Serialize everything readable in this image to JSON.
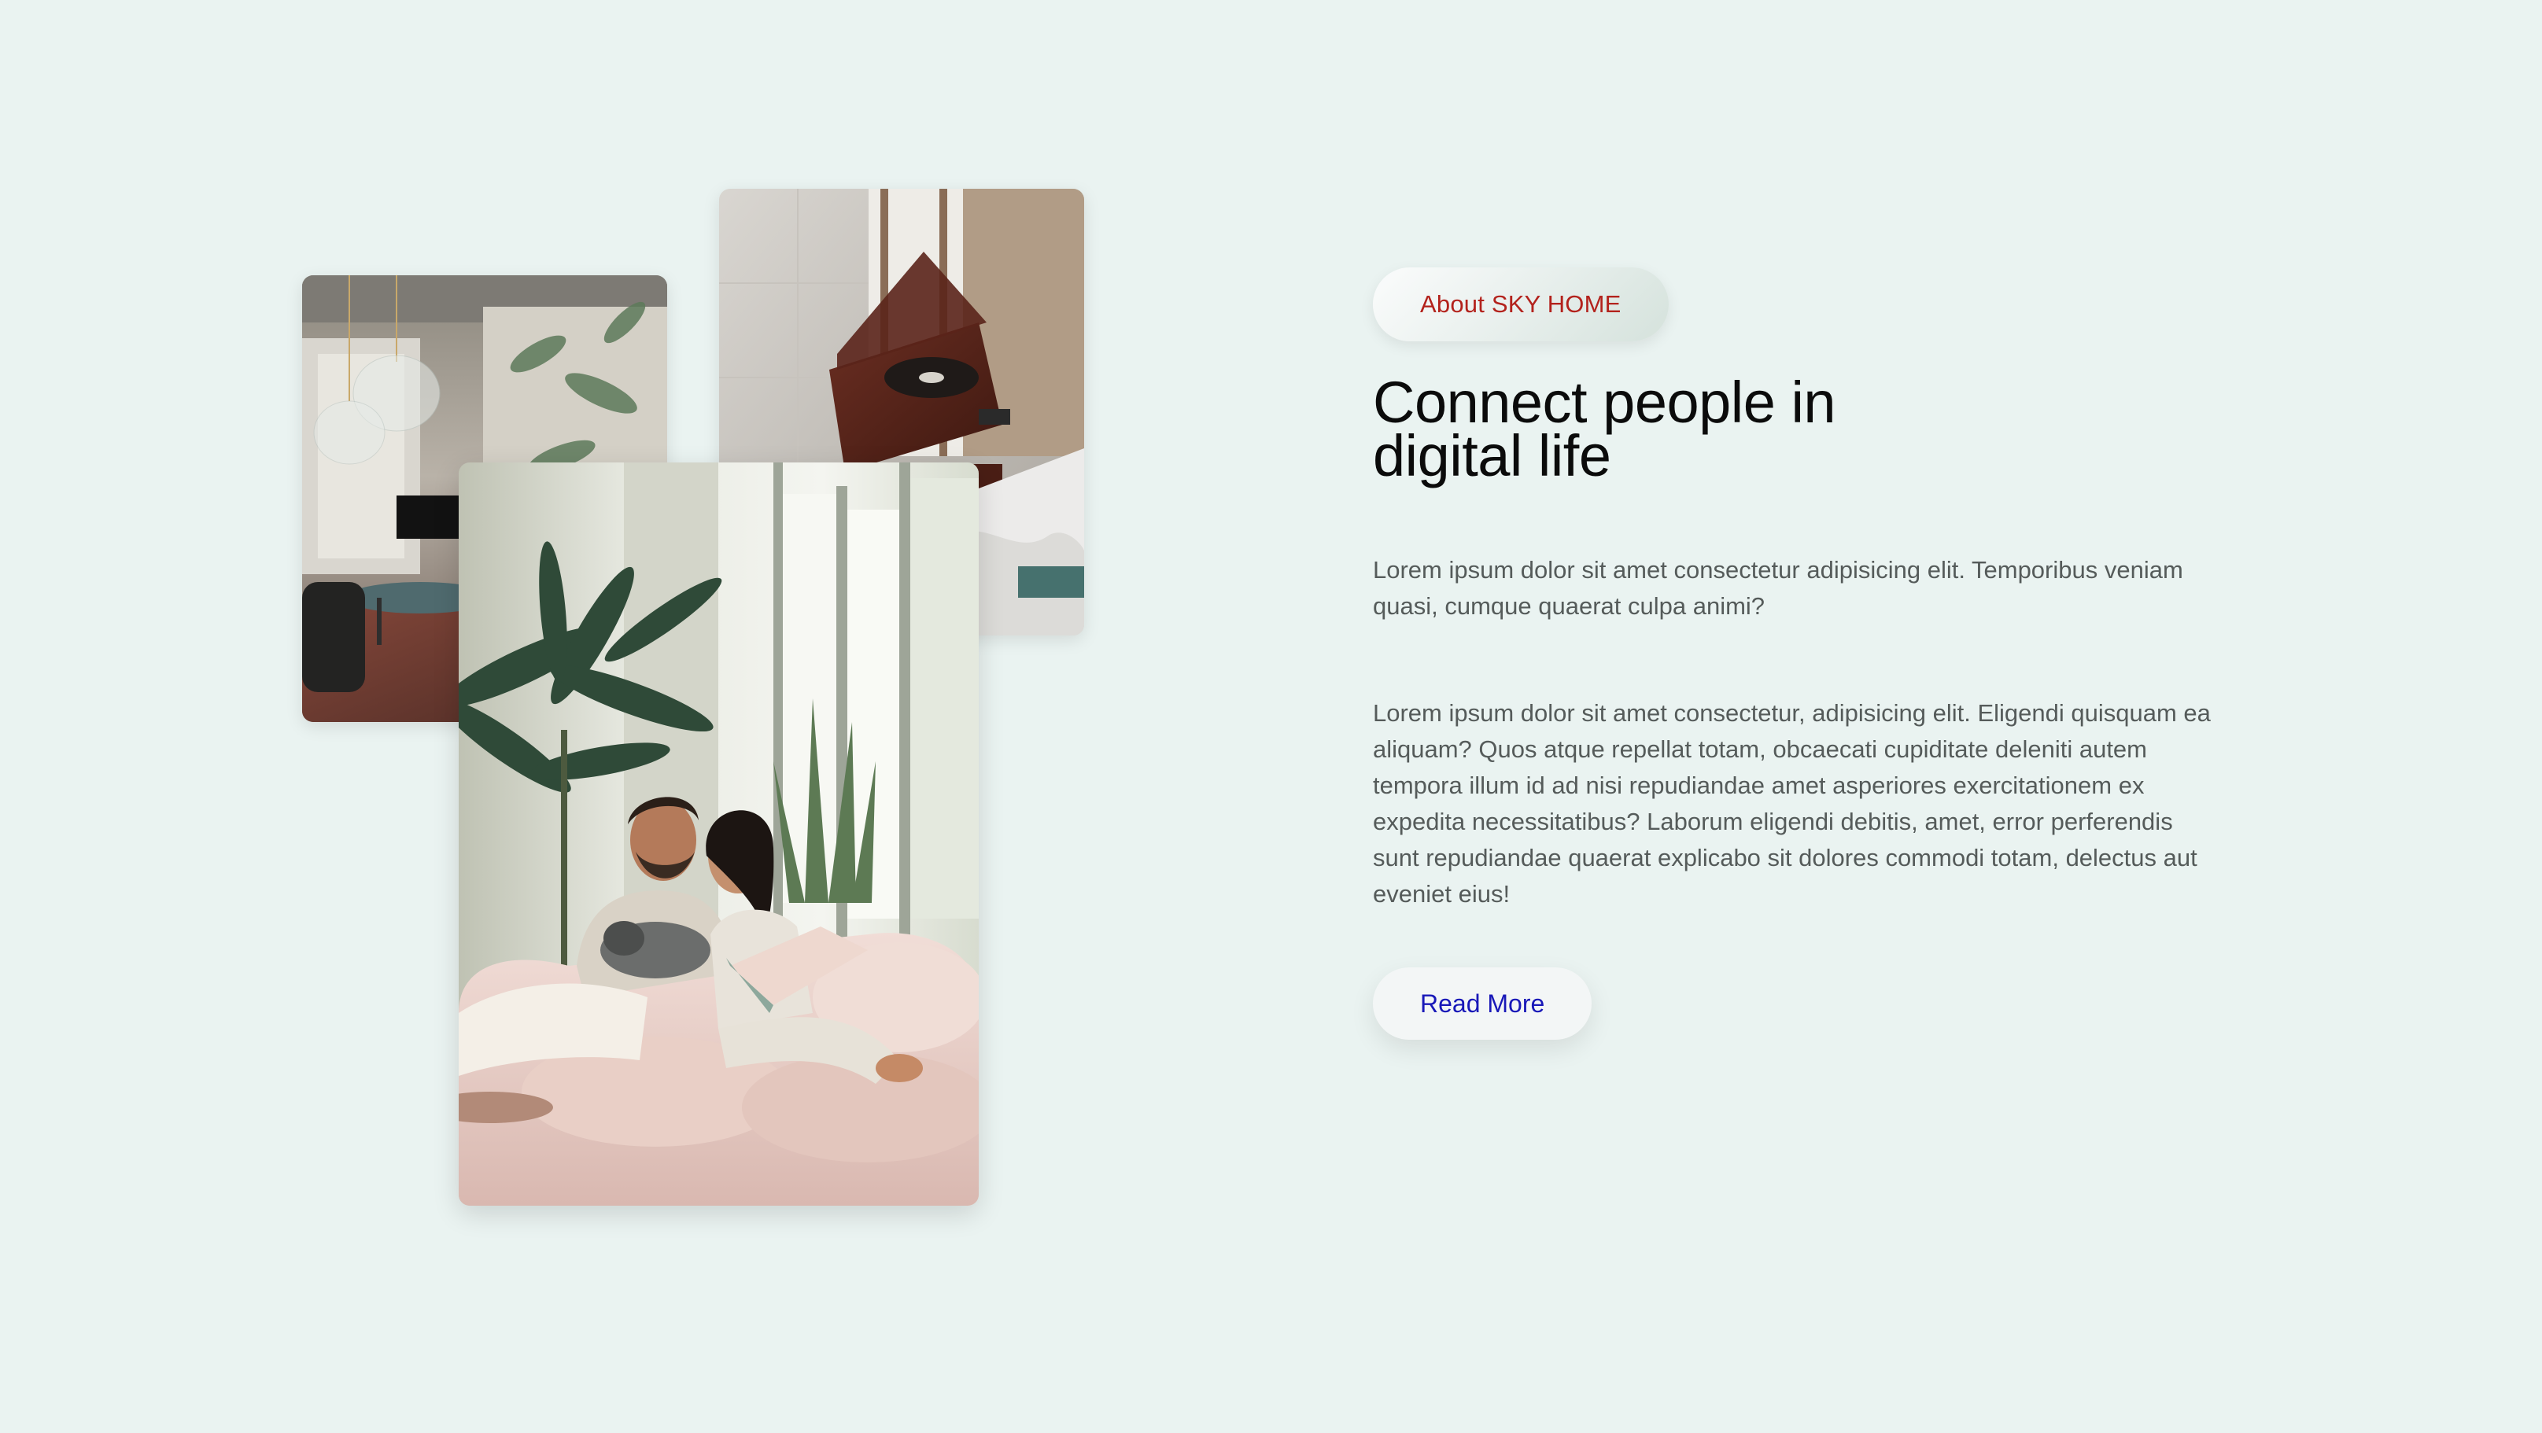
{
  "hero": {
    "images": {
      "interior": "Living room interior with plants and pendant lamps",
      "record": "Wooden record player by a window",
      "couple": "Couple reading on a sofa with a cat"
    }
  },
  "about": {
    "label": "About SKY HOME",
    "label_color": "#b3221c",
    "title": "Connect people in digital life",
    "paragraph_1": "Lorem ipsum dolor sit amet consectetur adipisicing elit. Temporibus veniam quasi, cumque quaerat culpa animi?",
    "paragraph_2": "Lorem ipsum dolor sit amet consectetur, adipisicing elit. Eligendi quisquam ea aliquam? Quos atque repellat totam, obcaecati cupiditate deleniti autem tempora illum id ad nisi repudiandae amet asperiores exercitationem ex expedita necessitatibus? Laborum eligendi debitis, amet, error perferendis sunt repudiandae quaerat explicabo sit dolores commodi totam, delectus aut eveniet eius!",
    "button_label": "Read More",
    "button_color": "#1818b8"
  },
  "colors": {
    "background": "#eaf3f1"
  }
}
